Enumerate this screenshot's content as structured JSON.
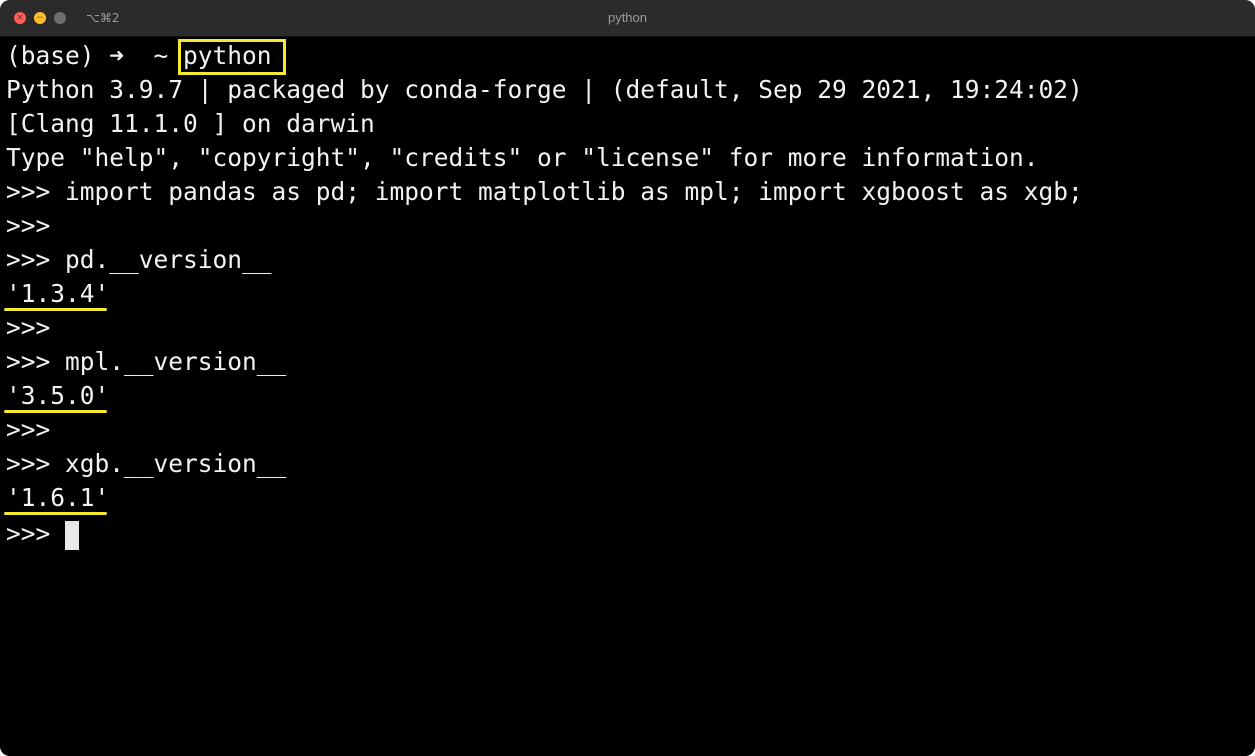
{
  "window": {
    "title": "python",
    "shortcut": "⌥⌘2"
  },
  "terminal": {
    "lines": [
      "(base) ➜  ~ python",
      "Python 3.9.7 | packaged by conda-forge | (default, Sep 29 2021, 19:24:02)",
      "[Clang 11.1.0 ] on darwin",
      "Type \"help\", \"copyright\", \"credits\" or \"license\" for more information.",
      ">>> import pandas as pd; import matplotlib as mpl; import xgboost as xgb;",
      ">>>",
      ">>> pd.__version__",
      "'1.3.4'",
      ">>>",
      ">>> mpl.__version__",
      "'3.5.0'",
      ">>>",
      ">>> xgb.__version__",
      "'1.6.1'",
      ">>> "
    ]
  },
  "annotations": {
    "highlight_color": "#f5e931",
    "boxed_text": "python",
    "underlined_lines": [
      "'1.3.4'",
      "'3.5.0'",
      "'1.6.1'"
    ]
  },
  "colors": {
    "background": "#000000",
    "text": "#f2f2f2",
    "titlebar": "#2b2b2b",
    "close": "#fe5f57",
    "minimize": "#febc2e",
    "maximize": "#6e6e6e"
  }
}
